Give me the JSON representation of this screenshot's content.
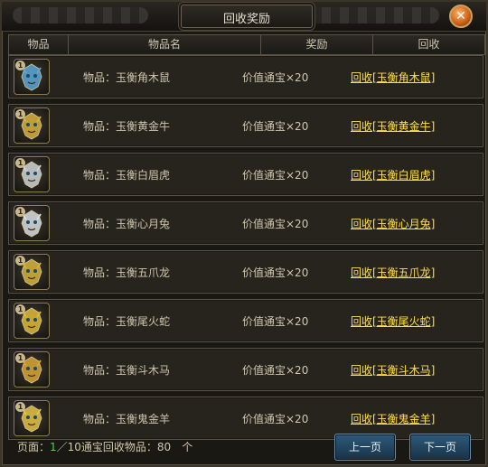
{
  "window": {
    "title": "回收奖励",
    "close_icon": "close-icon"
  },
  "header": {
    "columns": [
      "物品",
      "物品名",
      "奖励",
      "回收"
    ]
  },
  "rows": [
    {
      "item_label": "物品：玉衡角木鼠",
      "reward": "价值通宝×20",
      "action": "回收[玉衡角木鼠]",
      "icon": "rat-mask-icon",
      "color": "#5aa6d8"
    },
    {
      "item_label": "物品：玉衡黄金牛",
      "reward": "价值通宝×20",
      "action": "回收[玉衡黄金牛]",
      "icon": "ox-mask-icon",
      "color": "#d7b03a"
    },
    {
      "item_label": "物品：玉衡白眉虎",
      "reward": "价值通宝×20",
      "action": "回收[玉衡白眉虎]",
      "icon": "tiger-mask-icon",
      "color": "#cfd4d6"
    },
    {
      "item_label": "物品：玉衡心月兔",
      "reward": "价值通宝×20",
      "action": "回收[玉衡心月兔]",
      "icon": "rabbit-mask-icon",
      "color": "#d8dde0"
    },
    {
      "item_label": "物品：玉衡五爪龙",
      "reward": "价值通宝×20",
      "action": "回收[玉衡五爪龙]",
      "icon": "dragon-mask-icon",
      "color": "#d6b338"
    },
    {
      "item_label": "物品：玉衡尾火蛇",
      "reward": "价值通宝×20",
      "action": "回收[玉衡尾火蛇]",
      "icon": "snake-mask-icon",
      "color": "#e0b936"
    },
    {
      "item_label": "物品：玉衡斗木马",
      "reward": "价值通宝×20",
      "action": "回收[玉衡斗木马]",
      "icon": "horse-mask-icon",
      "color": "#d9a434"
    },
    {
      "item_label": "物品：玉衡鬼金羊",
      "reward": "价值通宝×20",
      "action": "回收[玉衡鬼金羊]",
      "icon": "goat-mask-icon",
      "color": "#e4c244"
    }
  ],
  "badge_text": "1",
  "footer": {
    "page_prefix": "页面：",
    "current_page": "1",
    "page_suffix": "／10通宝回收物品：80　个",
    "prev_label": "上一页",
    "next_label": "下一页"
  }
}
